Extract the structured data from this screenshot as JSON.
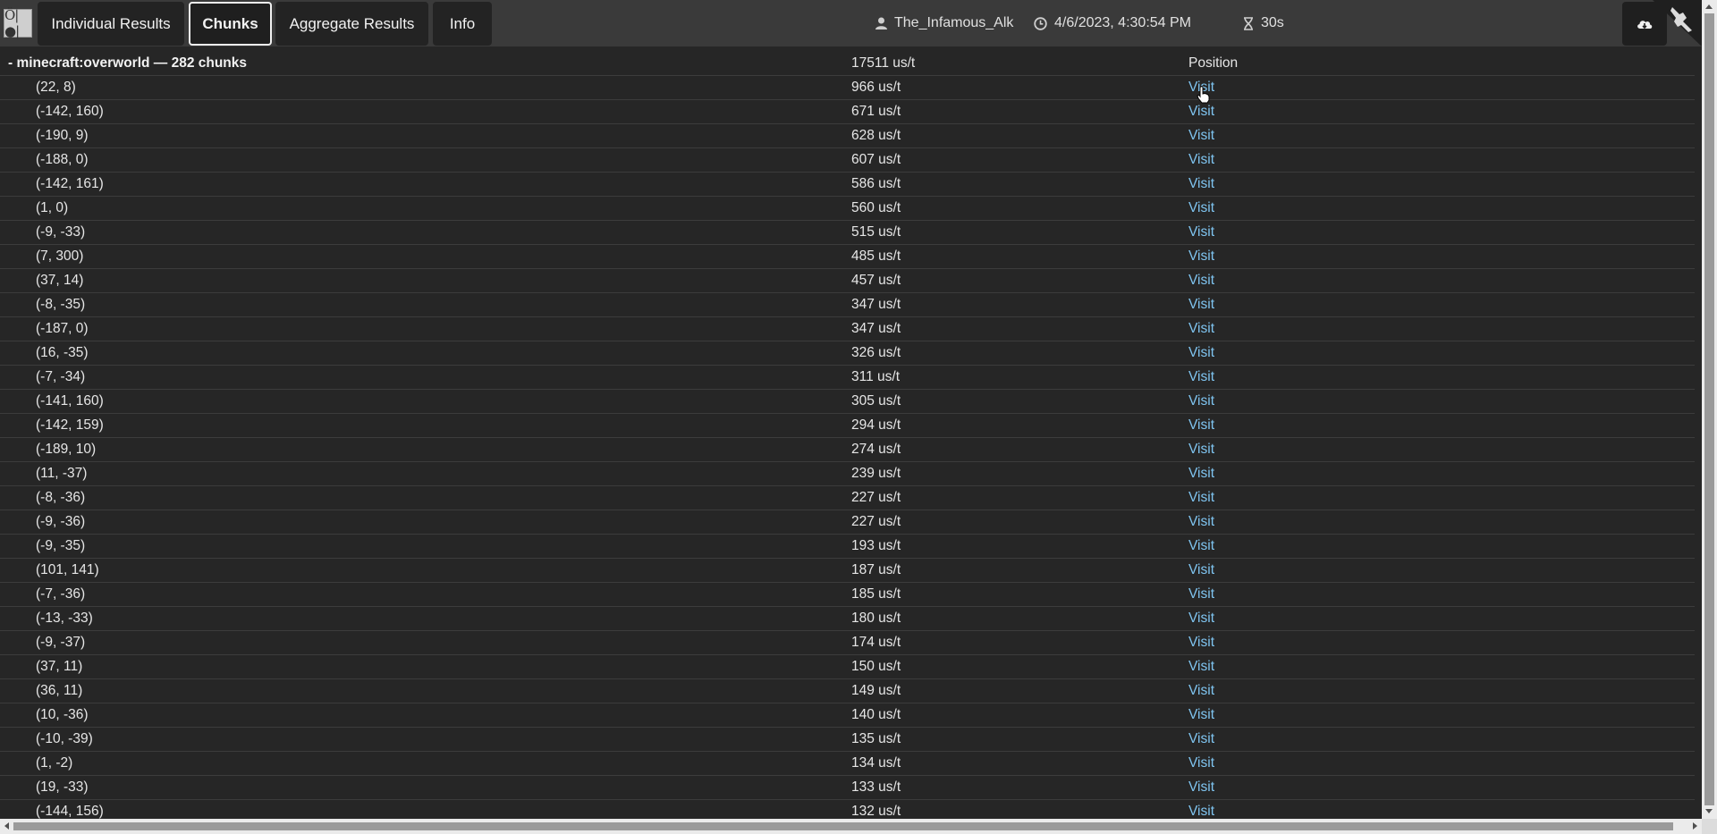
{
  "app": {
    "logo_text": "Ö|●|",
    "tabs": [
      {
        "label": "Individual Results",
        "active": false
      },
      {
        "label": "Chunks",
        "active": true
      },
      {
        "label": "Aggregate Results",
        "active": false
      },
      {
        "label": "Info",
        "active": false
      }
    ],
    "meta": {
      "user": "The_Infamous_Alk",
      "datetime": "4/6/2023, 4:30:54 PM",
      "duration": "30s"
    },
    "colors": {
      "background": "#262626",
      "topbar": "#3a3a3a",
      "link": "#7fc4f0"
    }
  },
  "table": {
    "group_label": "- minecraft:overworld — 282 chunks",
    "group_total": "17511 us/t",
    "position_header": "Position",
    "rows": [
      {
        "chunk": "(22, 8)",
        "time": "966 us/t",
        "action": "Visit"
      },
      {
        "chunk": "(-142, 160)",
        "time": "671 us/t",
        "action": "Visit"
      },
      {
        "chunk": "(-190, 9)",
        "time": "628 us/t",
        "action": "Visit"
      },
      {
        "chunk": "(-188, 0)",
        "time": "607 us/t",
        "action": "Visit"
      },
      {
        "chunk": "(-142, 161)",
        "time": "586 us/t",
        "action": "Visit"
      },
      {
        "chunk": "(1, 0)",
        "time": "560 us/t",
        "action": "Visit"
      },
      {
        "chunk": "(-9, -33)",
        "time": "515 us/t",
        "action": "Visit"
      },
      {
        "chunk": "(7, 300)",
        "time": "485 us/t",
        "action": "Visit"
      },
      {
        "chunk": "(37, 14)",
        "time": "457 us/t",
        "action": "Visit"
      },
      {
        "chunk": "(-8, -35)",
        "time": "347 us/t",
        "action": "Visit"
      },
      {
        "chunk": "(-187, 0)",
        "time": "347 us/t",
        "action": "Visit"
      },
      {
        "chunk": "(16, -35)",
        "time": "326 us/t",
        "action": "Visit"
      },
      {
        "chunk": "(-7, -34)",
        "time": "311 us/t",
        "action": "Visit"
      },
      {
        "chunk": "(-141, 160)",
        "time": "305 us/t",
        "action": "Visit"
      },
      {
        "chunk": "(-142, 159)",
        "time": "294 us/t",
        "action": "Visit"
      },
      {
        "chunk": "(-189, 10)",
        "time": "274 us/t",
        "action": "Visit"
      },
      {
        "chunk": "(11, -37)",
        "time": "239 us/t",
        "action": "Visit"
      },
      {
        "chunk": "(-8, -36)",
        "time": "227 us/t",
        "action": "Visit"
      },
      {
        "chunk": "(-9, -36)",
        "time": "227 us/t",
        "action": "Visit"
      },
      {
        "chunk": "(-9, -35)",
        "time": "193 us/t",
        "action": "Visit"
      },
      {
        "chunk": "(101, 141)",
        "time": "187 us/t",
        "action": "Visit"
      },
      {
        "chunk": "(-7, -36)",
        "time": "185 us/t",
        "action": "Visit"
      },
      {
        "chunk": "(-13, -33)",
        "time": "180 us/t",
        "action": "Visit"
      },
      {
        "chunk": "(-9, -37)",
        "time": "174 us/t",
        "action": "Visit"
      },
      {
        "chunk": "(37, 11)",
        "time": "150 us/t",
        "action": "Visit"
      },
      {
        "chunk": "(36, 11)",
        "time": "149 us/t",
        "action": "Visit"
      },
      {
        "chunk": "(10, -36)",
        "time": "140 us/t",
        "action": "Visit"
      },
      {
        "chunk": "(-10, -39)",
        "time": "135 us/t",
        "action": "Visit"
      },
      {
        "chunk": "(1, -2)",
        "time": "134 us/t",
        "action": "Visit"
      },
      {
        "chunk": "(19, -33)",
        "time": "133 us/t",
        "action": "Visit"
      },
      {
        "chunk": "(-144, 156)",
        "time": "132 us/t",
        "action": "Visit"
      }
    ]
  }
}
